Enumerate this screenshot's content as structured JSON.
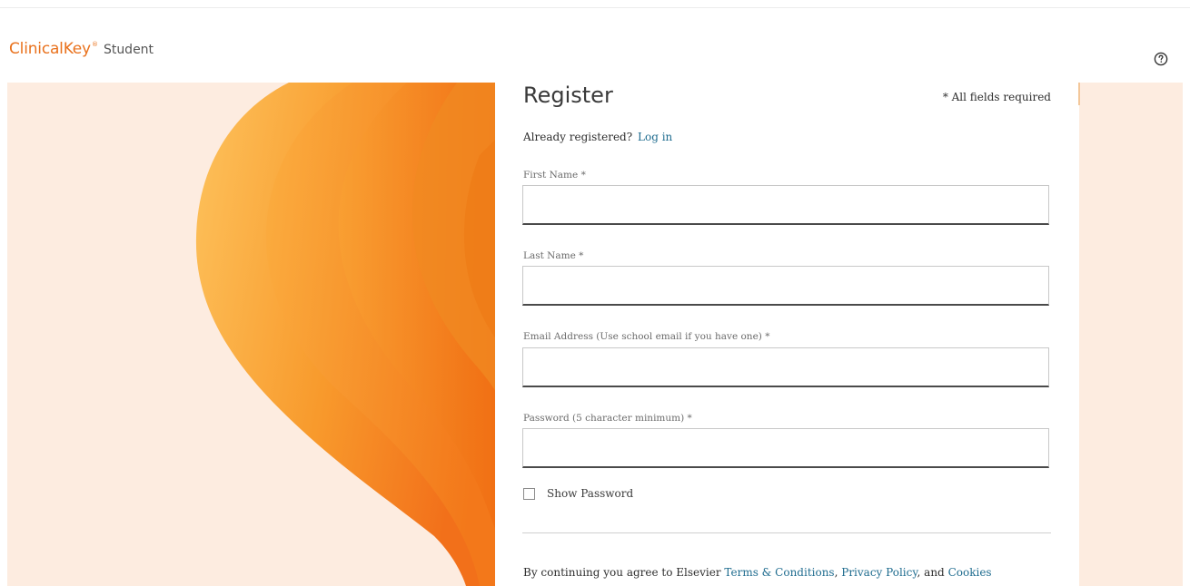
{
  "header": {
    "brand_main": "ClinicalKey",
    "brand_tm": "®",
    "brand_sub": "Student",
    "help_icon": "help-circle-icon"
  },
  "form": {
    "title": "Register",
    "required_note": "* All fields required",
    "already_text": "Already registered?",
    "login_link": "Log in",
    "fields": [
      {
        "label": "First Name *",
        "value": "",
        "placeholder": ""
      },
      {
        "label": "Last Name *",
        "value": "",
        "placeholder": ""
      },
      {
        "label": "Email Address (Use school email if you have one) *",
        "value": "",
        "placeholder": ""
      },
      {
        "label": "Password (5 character minimum) *",
        "value": "",
        "placeholder": ""
      }
    ],
    "show_password_label": "Show Password",
    "show_password_checked": false,
    "terms_prefix": "By continuing you agree to Elsevier",
    "terms_link": "Terms & Conditions",
    "privacy_link": "Privacy Policy",
    "and_text": ", and",
    "cookies_link": "Cookies"
  },
  "colors": {
    "brand": "#e9711c",
    "link": "#1f6c8f",
    "background_tint": "#fdece0",
    "flame_light": "#fbb24a",
    "flame_dark": "#f26a10"
  }
}
